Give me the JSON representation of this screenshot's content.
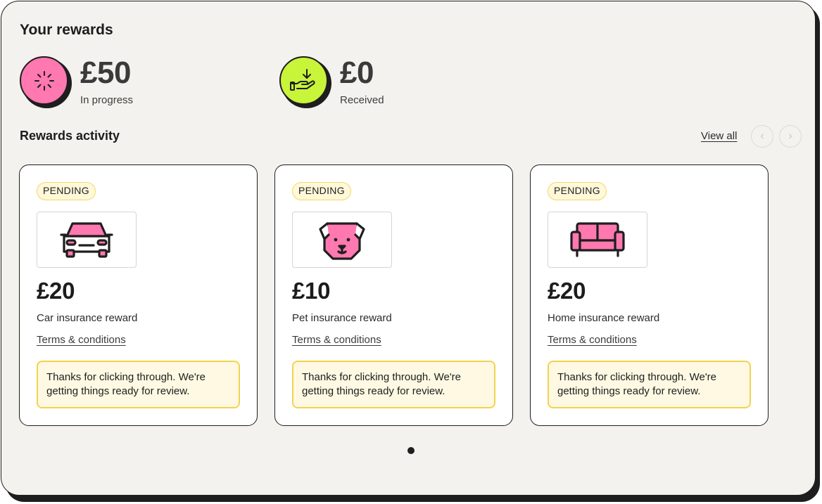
{
  "header": {
    "title": "Your rewards"
  },
  "summary": [
    {
      "amount": "£50",
      "label": "In progress",
      "icon": "sparkle-loading-icon",
      "color": "#ff78b0"
    },
    {
      "amount": "£0",
      "label": "Received",
      "icon": "hand-receive-icon",
      "color": "#c8f43a"
    }
  ],
  "activity": {
    "title": "Rewards activity",
    "view_all": "View all",
    "prev_icon": "chevron-left-icon",
    "next_icon": "chevron-right-icon",
    "cards": [
      {
        "status": "PENDING",
        "icon": "car-icon",
        "amount": "£20",
        "label": "Car insurance reward",
        "terms": "Terms & conditions",
        "notice": "Thanks for clicking through. We're getting things ready for review."
      },
      {
        "status": "PENDING",
        "icon": "dog-icon",
        "amount": "£10",
        "label": "Pet insurance reward",
        "terms": "Terms & conditions",
        "notice": "Thanks for clicking through. We're getting things ready for review."
      },
      {
        "status": "PENDING",
        "icon": "sofa-icon",
        "amount": "£20",
        "label": "Home insurance reward",
        "terms": "Terms & conditions",
        "notice": "Thanks for clicking through. We're getting things ready for review."
      }
    ]
  },
  "pagination": {
    "current": 1,
    "total": 1
  },
  "colors": {
    "pending_border": "#f3d86a",
    "notice_border": "#f3d24f",
    "icon_pink": "#ff78b0",
    "lime": "#c8f43a"
  }
}
